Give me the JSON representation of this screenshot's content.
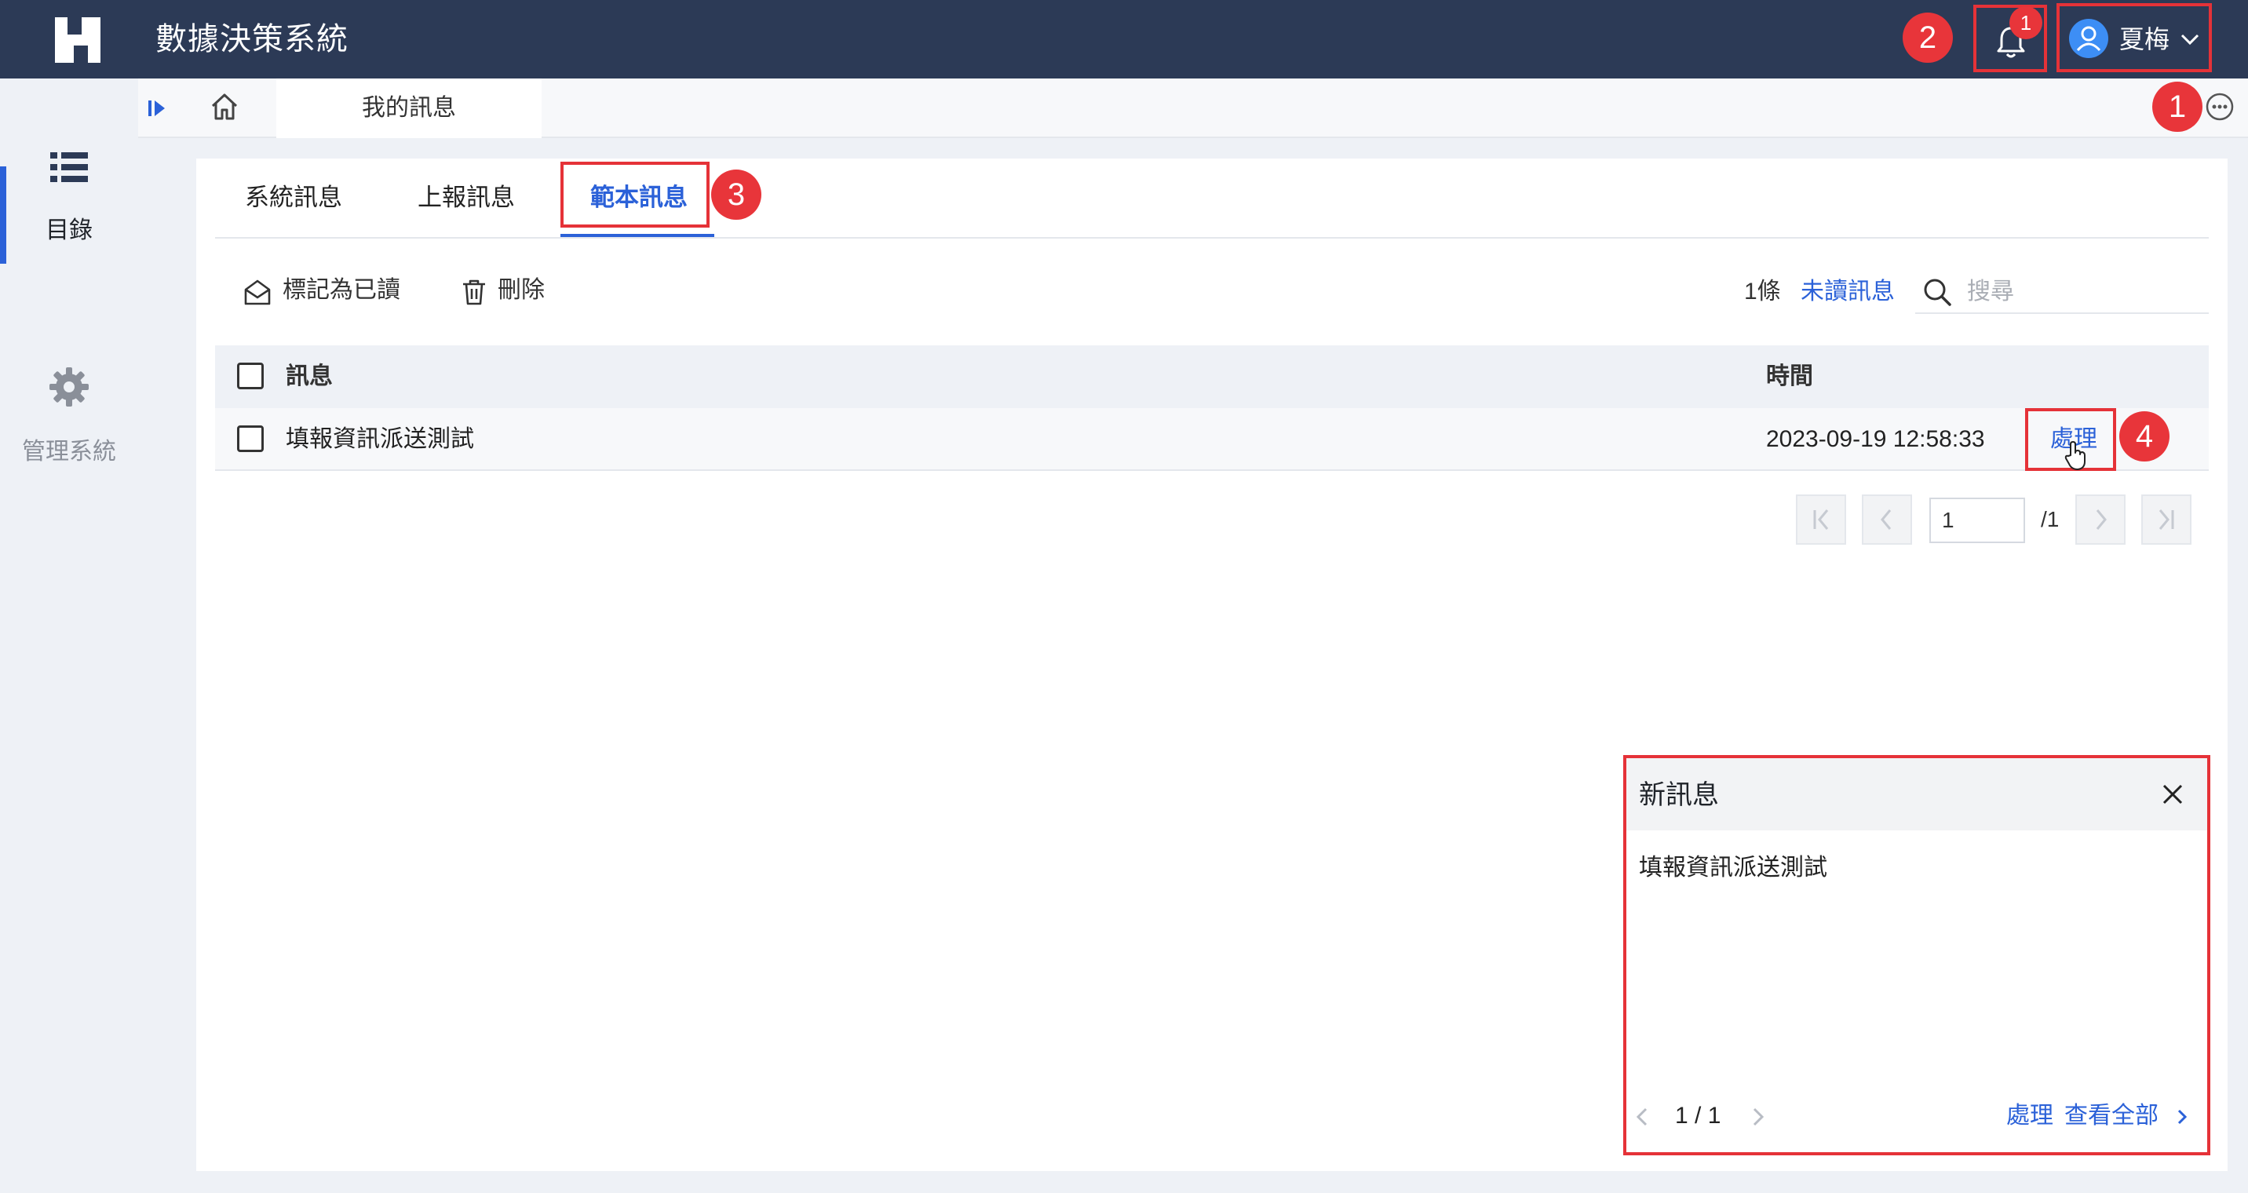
{
  "app": {
    "title": "數據決策系統"
  },
  "header": {
    "notification_count": "1",
    "user_name": "夏梅"
  },
  "annotations": {
    "step1": "1",
    "step2": "2",
    "step3": "3",
    "step4": "4"
  },
  "sidebar": {
    "items": [
      {
        "label": "目錄",
        "icon": "list-icon",
        "active": true
      },
      {
        "label": "管理系統",
        "icon": "gear-icon",
        "active": false
      }
    ]
  },
  "tabstrip": {
    "current_tab": "我的訊息"
  },
  "messages": {
    "tabs": [
      {
        "label": "系統訊息"
      },
      {
        "label": "上報訊息"
      },
      {
        "label": "範本訊息",
        "active": true
      }
    ],
    "toolbar": {
      "mark_read": "標記為已讀",
      "delete": "刪除",
      "count": "1條",
      "unread_filter": "未讀訊息",
      "search_placeholder": "搜尋"
    },
    "table": {
      "columns": [
        "訊息",
        "時間"
      ],
      "rows": [
        {
          "message": "填報資訊派送測試",
          "time": "2023-09-19 12:58:33",
          "action": "處理"
        }
      ]
    },
    "pagination": {
      "page": "1",
      "total": "/1"
    }
  },
  "popup": {
    "title": "新訊息",
    "message": "填報資訊派送測試",
    "page_indicator": "1 / 1",
    "process": "處理",
    "view_all": "查看全部"
  },
  "colors": {
    "topbar": "#2c3a56",
    "accent": "#2b61d8",
    "annotation_red": "#e8353a"
  }
}
